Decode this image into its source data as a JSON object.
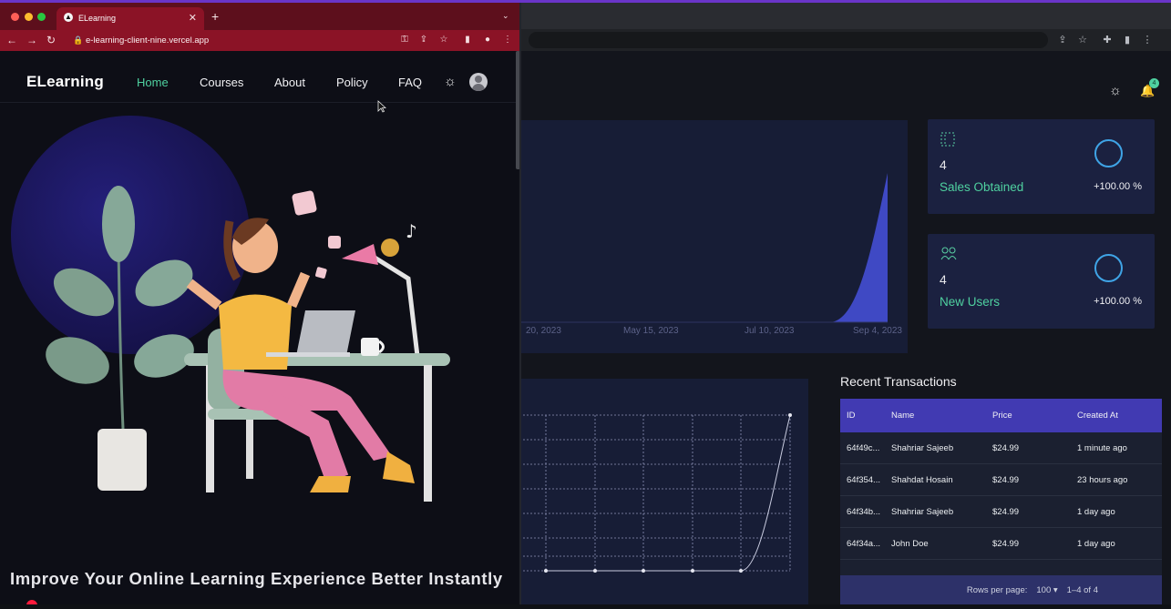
{
  "colors": {
    "accent_green": "#4fd1a0",
    "table_header": "#413ab2",
    "chart_fill": "#3f49c4",
    "browser_red": "#8b1326"
  },
  "browser": {
    "tab_title": "ELearning",
    "url": "e-learning-client-nine.vercel.app"
  },
  "site": {
    "logo": "ELearning",
    "nav": [
      "Home",
      "Courses",
      "About",
      "Policy",
      "FAQ"
    ],
    "hero_headline": "Improve Your Online Learning Experience Better Instantly"
  },
  "dashboard": {
    "notification_count": "4",
    "area_chart": {
      "x_ticks": [
        "20, 2023",
        "May 15, 2023",
        "Jul 10, 2023",
        "Sep 4, 2023"
      ]
    },
    "stats": [
      {
        "value": "4",
        "label": "Sales Obtained",
        "percent": "+100.00 %",
        "icon": "sales-grid-icon"
      },
      {
        "value": "4",
        "label": "New Users",
        "percent": "+100.00 %",
        "icon": "users-icon"
      }
    ],
    "transactions": {
      "title": "Recent Transactions",
      "columns": [
        "ID",
        "Name",
        "Price",
        "Created At"
      ],
      "rows": [
        [
          "64f49c...",
          "Shahriar Sajeeb",
          "$24.99",
          "1 minute ago"
        ],
        [
          "64f354...",
          "Shahdat Hosain",
          "$24.99",
          "23 hours ago"
        ],
        [
          "64f34b...",
          "Shahriar Sajeeb",
          "$24.99",
          "1 day ago"
        ],
        [
          "64f34a...",
          "John Doe",
          "$24.99",
          "1 day ago"
        ]
      ],
      "rows_per_page_label": "Rows per page:",
      "rows_per_page": "100",
      "pagination": "1–4 of 4"
    }
  }
}
